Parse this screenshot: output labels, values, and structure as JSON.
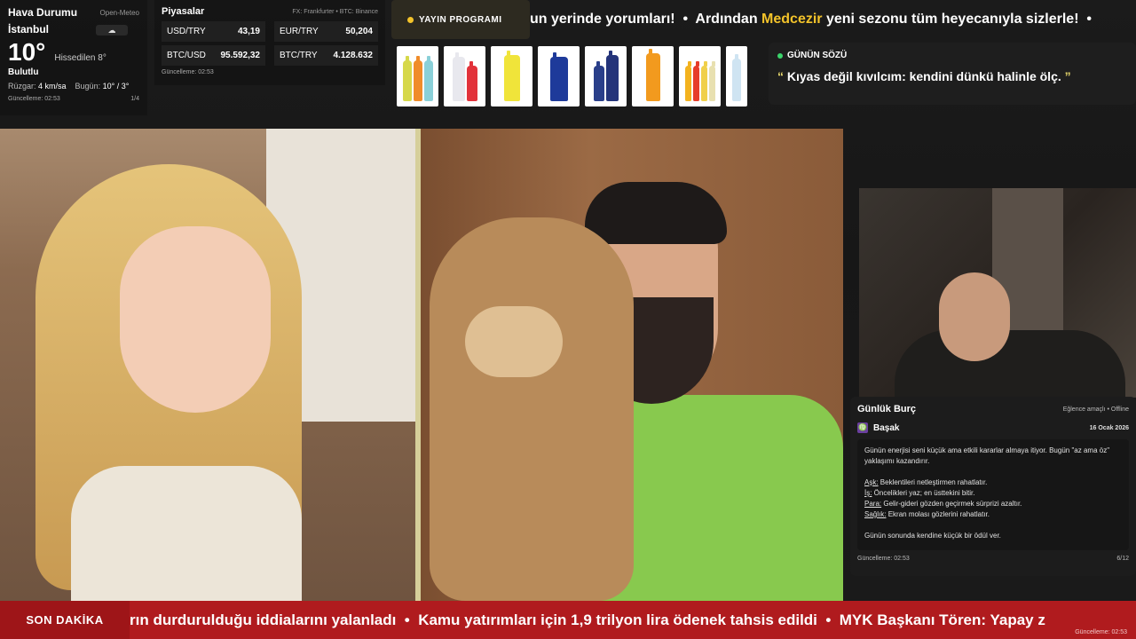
{
  "weather": {
    "title": "Hava Durumu",
    "source": "Open-Meteo",
    "city": "İstanbul",
    "condition_icon": "cloud-icon",
    "temp": "10°",
    "feels": "Hissedilen 8°",
    "desc": "Bulutlu",
    "wind_label": "Rüzgar:",
    "wind_value": "4 km/sa",
    "today_label": "Bugün:",
    "today_value": "10° / 3°",
    "updated": "Güncelleme: 02:53",
    "page": "1/4"
  },
  "markets": {
    "title": "Piyasalar",
    "source": "FX: Frankfurter • BTC: Binance",
    "items": [
      {
        "name": "USD/TRY",
        "value": "43,19"
      },
      {
        "name": "EUR/TRY",
        "value": "50,204"
      },
      {
        "name": "BTC/USD",
        "value": "95.592,32"
      },
      {
        "name": "BTC/TRY",
        "value": "4.128.632"
      }
    ],
    "updated": "Güncelleme: 02:53"
  },
  "program": {
    "label": "YAYIN PROGRAMI",
    "ticker_a": "un yerinde yorumları!  •  Ardından ",
    "ticker_hl": "Medcezir",
    "ticker_b": " yeni sezonu tüm heyecanıyla sizlerle!  •",
    "accent": "#f3c32a"
  },
  "quote": {
    "label": "GÜNÜN SÖZÜ",
    "open": "“",
    "text": "Kıyas değil kıvılcım: kendini dünkü halinle ölç.",
    "close": "”"
  },
  "horoscope": {
    "title": "Günlük Burç",
    "note": "Eğlence amaçlı • Offline",
    "sign": "Başak",
    "sign_icon": "virgo-icon",
    "date": "16 Ocak 2026",
    "intro": "Günün enerjisi seni küçük ama etkili kararlar almaya itiyor. Bugün \"az ama öz\" yaklaşımı kazandırır.",
    "love_label": "Aşk:",
    "love": " Beklentileri netleştirmen rahatlatır.",
    "work_label": "İş:",
    "work": " Öncelikleri yaz; en üsttekini bitir.",
    "money_label": "Para:",
    "money": " Gelir-gideri gözden geçirmek sürprizi azaltır.",
    "health_label": "Sağlık:",
    "health": " Ekran molası gözlerini rahatlatır.",
    "closing": "Günün sonunda kendine küçük bir ödül ver.",
    "updated": "Güncelleme: 02:53",
    "page": "6/12"
  },
  "news": {
    "label": "SON DAKİKA",
    "ticker": "rın durdurulduğu iddialarını yalanladı  •  Kamu yatırımları için 1,9 trilyon lira ödenek tahsis edildi  •  MYK Başkanı Tören: Yapay z",
    "updated": "Güncelleme: 02:53",
    "color": "#b01b1e"
  }
}
